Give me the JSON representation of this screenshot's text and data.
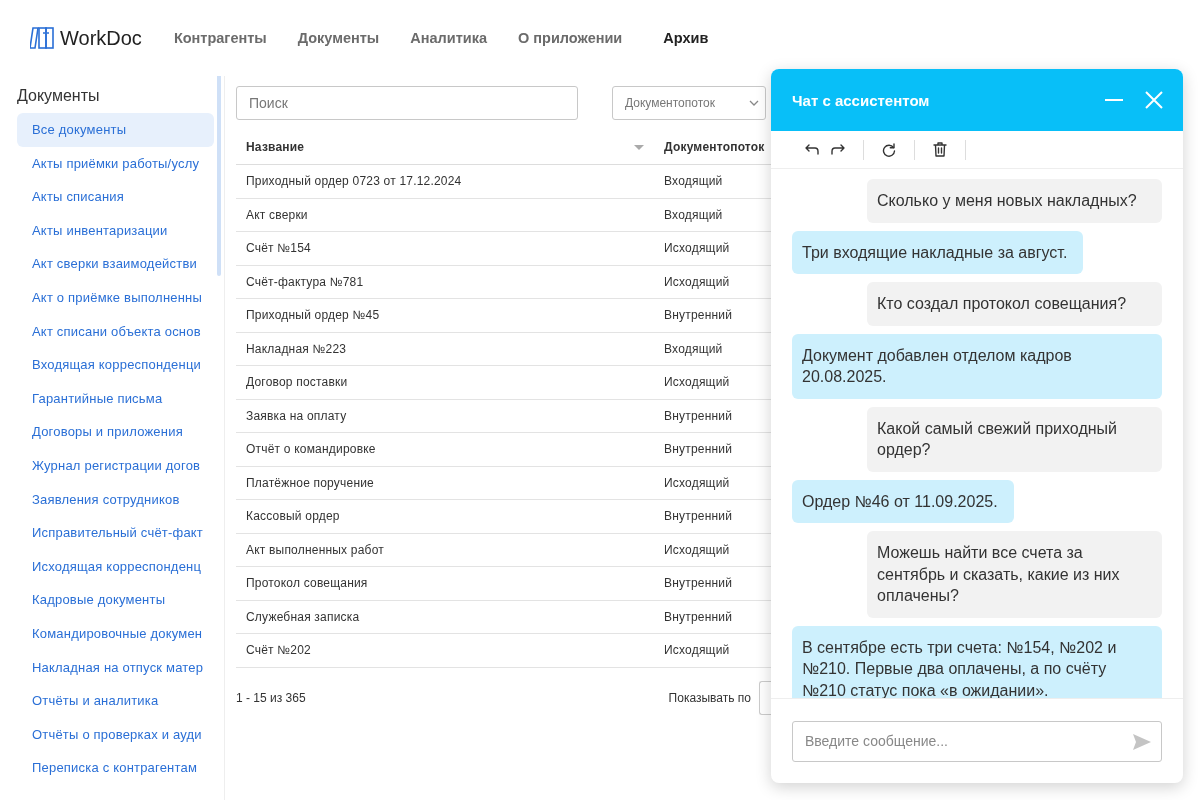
{
  "app": {
    "logo": "WorkDoc"
  },
  "nav": [
    {
      "label": "Контрагенты",
      "selected": false
    },
    {
      "label": "Документы",
      "selected": false
    },
    {
      "label": "Аналитика",
      "selected": false
    },
    {
      "label": "О приложении",
      "selected": false
    },
    {
      "label": "Архив",
      "selected": true
    }
  ],
  "sidebar": {
    "title": "Документы",
    "items": [
      {
        "label": "Все документы",
        "selected": true
      },
      {
        "label": "Акты приёмки работы/услу",
        "selected": false
      },
      {
        "label": "Акты списания",
        "selected": false
      },
      {
        "label": "Акты инвентаризации",
        "selected": false
      },
      {
        "label": "Акт сверки взаимодействи",
        "selected": false
      },
      {
        "label": "Акт о приёмке выполненны",
        "selected": false
      },
      {
        "label": "Акт списани объекта основ",
        "selected": false
      },
      {
        "label": "Входящая корреспонденци",
        "selected": false
      },
      {
        "label": "Гарантийные письма",
        "selected": false
      },
      {
        "label": "Договоры и приложения",
        "selected": false
      },
      {
        "label": "Журнал регистрации догов",
        "selected": false
      },
      {
        "label": "Заявления сотрудников",
        "selected": false
      },
      {
        "label": "Исправительный счёт-факт",
        "selected": false
      },
      {
        "label": "Исходящая корреспонденц",
        "selected": false
      },
      {
        "label": "Кадровые документы",
        "selected": false
      },
      {
        "label": "Командировочные докумен",
        "selected": false
      },
      {
        "label": "Накладная на отпуск матер",
        "selected": false
      },
      {
        "label": "Отчёты и аналитика",
        "selected": false
      },
      {
        "label": "Отчёты о проверках и ауди",
        "selected": false
      },
      {
        "label": "Переписка с контрагентам",
        "selected": false
      }
    ]
  },
  "search": {
    "placeholder": "Поиск"
  },
  "filter": {
    "placeholder": "Документопоток"
  },
  "table": {
    "columns": [
      "Название",
      "Документопоток"
    ],
    "rows": [
      {
        "name": "Приходный ордер 0723 от 17.12.2024",
        "flow": "Входящий"
      },
      {
        "name": "Акт сверки",
        "flow": "Входящий"
      },
      {
        "name": "Счёт №154",
        "flow": "Исходящий"
      },
      {
        "name": "Счёт-фактура №781",
        "flow": "Исходящий"
      },
      {
        "name": "Приходный ордер №45",
        "flow": "Внутренний"
      },
      {
        "name": "Накладная №223",
        "flow": "Входящий"
      },
      {
        "name": "Договор поставки",
        "flow": "Исходящий"
      },
      {
        "name": "Заявка на оплату",
        "flow": "Внутренний"
      },
      {
        "name": "Отчёт о командировке",
        "flow": "Внутренний"
      },
      {
        "name": "Платёжное поручение",
        "flow": "Исходящий"
      },
      {
        "name": "Кассовый ордер",
        "flow": "Внутренний"
      },
      {
        "name": "Акт выполненных работ",
        "flow": "Исходящий"
      },
      {
        "name": "Протокол совещания",
        "flow": "Внутренний"
      },
      {
        "name": "Служебная записка",
        "flow": "Внутренний"
      },
      {
        "name": "Счёт №202",
        "flow": "Исходящий"
      }
    ]
  },
  "pagination": {
    "range": "1 - 15 из 365",
    "page_size_label": "Показывать по"
  },
  "chat": {
    "title": "Чат с ассистентом",
    "messages": [
      {
        "kind": "user",
        "text": "Сколько у меня новых накладных?"
      },
      {
        "kind": "assistant",
        "text": "Три входящие накладные за август."
      },
      {
        "kind": "user",
        "text": "Кто создал протокол совещания?"
      },
      {
        "kind": "assistant",
        "text": "Документ добавлен отделом кадров 20.08.2025."
      },
      {
        "kind": "user",
        "text": "Какой самый свежий приходный ордер?"
      },
      {
        "kind": "assistant",
        "text": "Ордер №46 от 11.09.2025."
      },
      {
        "kind": "user",
        "text": "Можешь найти все счета за сентябрь и сказать, какие из них оплачены?"
      },
      {
        "kind": "assistant",
        "text": "В сентябре есть три счета: №154, №202 и №210. Первые два оплачены, а по счёту №210 статус пока «в ожидании»."
      }
    ],
    "input": {
      "placeholder": "Введите сообщение..."
    }
  }
}
